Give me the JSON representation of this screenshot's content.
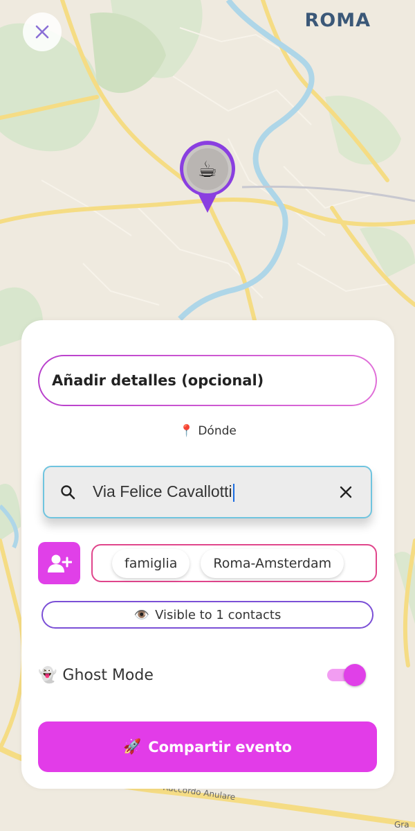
{
  "map": {
    "city": "ROMA",
    "road_label": "Raccordo Anulare",
    "road_label_partial": "Gra",
    "pin_emoji": "☕"
  },
  "close_icon": "close-icon",
  "sheet": {
    "details_placeholder": "Añadir detalles (opcional)",
    "where_emoji": "📍",
    "where_label": "Dónde",
    "search": {
      "value": "Via Felice Cavallotti",
      "search_icon": "search-icon",
      "clear_icon": "close-icon"
    },
    "add_contact_icon": "add-person-icon",
    "groups": [
      "famiglia",
      "Roma-Amsterdam"
    ],
    "visibility": {
      "emoji": "👁️",
      "label": "Visible to 1 contacts"
    },
    "ghost_mode": {
      "emoji": "👻",
      "label": "Ghost Mode",
      "enabled": true
    },
    "share_button": {
      "emoji": "🚀",
      "label": "Compartir evento"
    }
  },
  "colors": {
    "accent": "#e23ce8",
    "pin_ring": "#8a3fe0",
    "groups_border": "#e0458b",
    "visibility_border": "#7b4fd6",
    "search_border": "#6fc4df",
    "city_text": "#3b5878"
  }
}
